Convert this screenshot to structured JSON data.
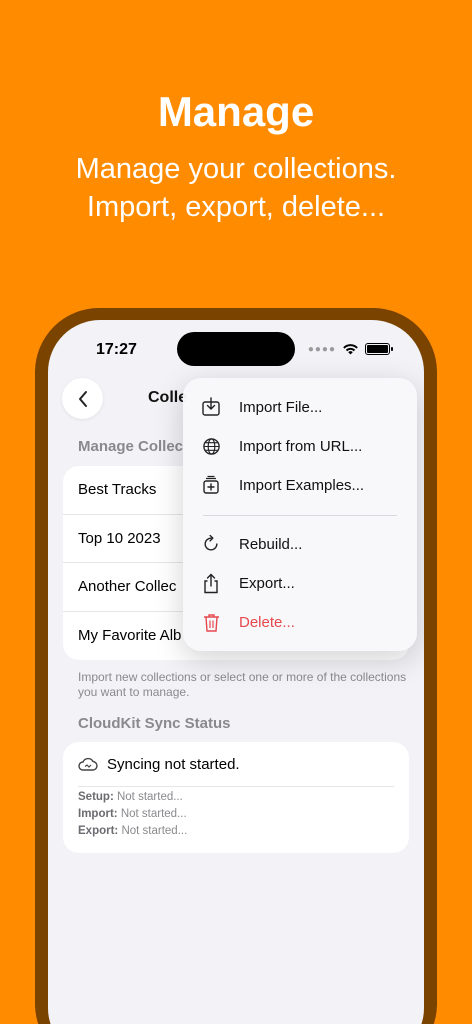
{
  "hero": {
    "title": "Manage",
    "subtitle": "Manage your collections. Import, export, delete..."
  },
  "status_bar": {
    "time": "17:27"
  },
  "nav": {
    "title": "Colle"
  },
  "collections_section": {
    "header": "Manage Collec",
    "items": [
      "Best Tracks",
      "Top 10 2023",
      "Another Collec",
      "My Favorite Alb"
    ],
    "footer": "Import new collections or select one or more of the collections you want to manage."
  },
  "sync_section": {
    "header": "CloudKit Sync Status",
    "status": "Syncing not started.",
    "rows": [
      {
        "label": "Setup:",
        "value": "Not started..."
      },
      {
        "label": "Import:",
        "value": "Not started..."
      },
      {
        "label": "Export:",
        "value": "Not started..."
      }
    ]
  },
  "menu": {
    "items": [
      {
        "label": "Import File...",
        "icon": "import-file-icon"
      },
      {
        "label": "Import from URL...",
        "icon": "globe-icon"
      },
      {
        "label": "Import Examples...",
        "icon": "import-examples-icon"
      },
      {
        "label": "Rebuild...",
        "icon": "rebuild-icon"
      },
      {
        "label": "Export...",
        "icon": "share-icon"
      },
      {
        "label": "Delete...",
        "icon": "trash-icon"
      }
    ]
  },
  "colors": {
    "background": "#FF8C00",
    "frame": "#7A4300",
    "destructive": "#E5484D"
  }
}
